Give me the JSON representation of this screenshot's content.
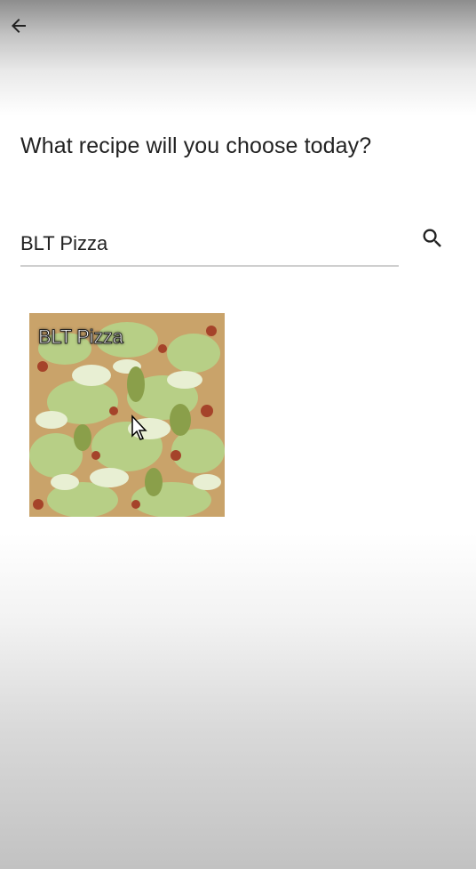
{
  "header": {
    "back_icon": "arrow-left-icon"
  },
  "prompt": {
    "text": "What recipe will you choose today?"
  },
  "search": {
    "value": "BLT Pizza",
    "icon": "search-icon"
  },
  "results": [
    {
      "title": "BLT Pizza",
      "image": "pizza-photo"
    }
  ],
  "colors": {
    "text": "#222222",
    "divider": "#cfcfcf"
  }
}
